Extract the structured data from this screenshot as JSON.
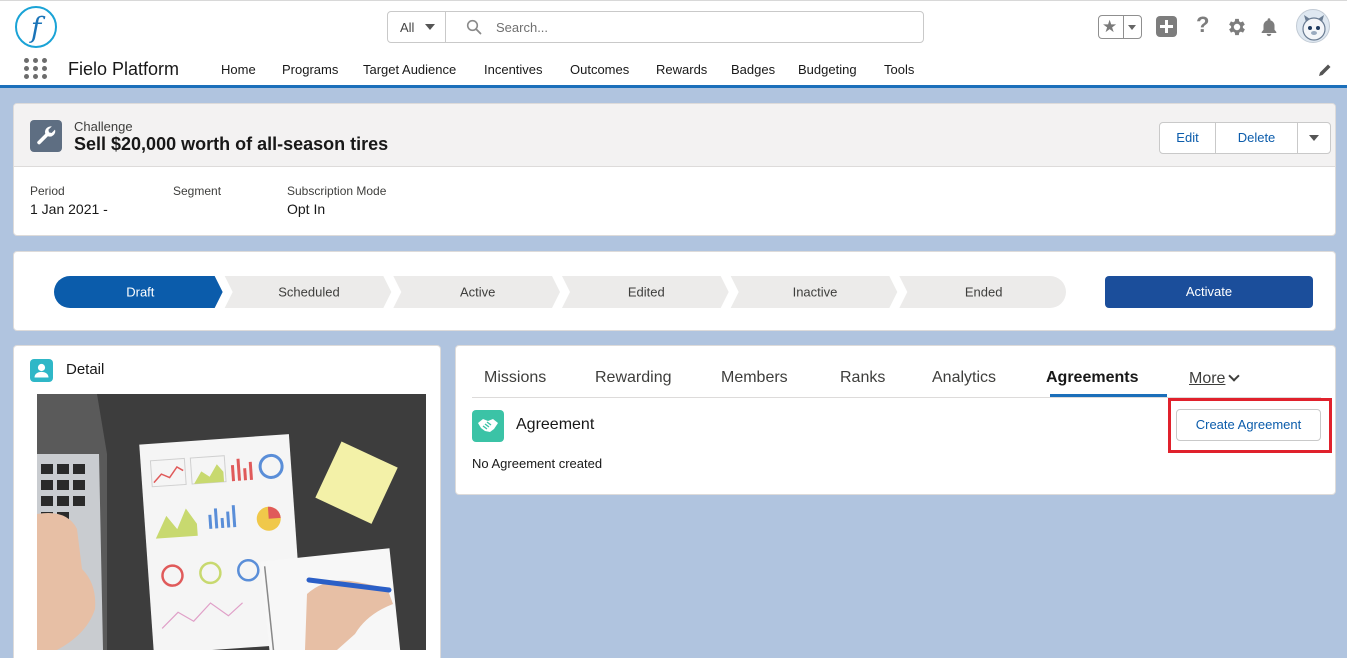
{
  "header": {
    "logo_letter": "f",
    "search": {
      "scope": "All",
      "placeholder": "Search..."
    },
    "icons": [
      "favorites-star-icon",
      "global-create-icon",
      "help-icon",
      "setup-gear-icon",
      "notifications-bell-icon",
      "user-avatar"
    ]
  },
  "nav": {
    "app_name": "Fielo Platform",
    "items": [
      {
        "label": "Home"
      },
      {
        "label": "Programs"
      },
      {
        "label": "Target Audience"
      },
      {
        "label": "Incentives"
      },
      {
        "label": "Outcomes"
      },
      {
        "label": "Rewards"
      },
      {
        "label": "Badges"
      },
      {
        "label": "Budgeting"
      },
      {
        "label": "Tools"
      }
    ]
  },
  "record": {
    "type": "Challenge",
    "title": "Sell $20,000 worth of all-season tires",
    "actions": {
      "edit": "Edit",
      "delete": "Delete"
    },
    "fields": [
      {
        "label": "Period",
        "value": "1 Jan 2021 -"
      },
      {
        "label": "Segment",
        "value": ""
      },
      {
        "label": "Subscription Mode",
        "value": "Opt In"
      }
    ]
  },
  "path": {
    "steps": [
      "Draft",
      "Scheduled",
      "Active",
      "Edited",
      "Inactive",
      "Ended"
    ],
    "current_index": 0,
    "action_label": "Activate",
    "colors": {
      "current": "#0b5cab",
      "pending": "#ecebea",
      "button": "#1b4e9b"
    }
  },
  "detail": {
    "title": "Detail"
  },
  "tabs": {
    "items": [
      "Missions",
      "Rewarding",
      "Members",
      "Ranks",
      "Analytics",
      "Agreements"
    ],
    "active": "Agreements",
    "more_label": "More"
  },
  "agreement": {
    "title": "Agreement",
    "empty_text": "No Agreement created",
    "create_label": "Create Agreement",
    "highlight_color": "#e0212c"
  }
}
